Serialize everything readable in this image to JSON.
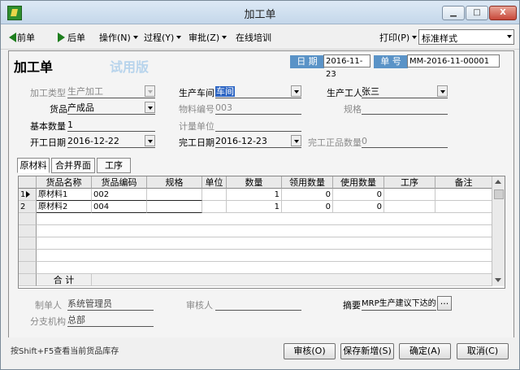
{
  "window": {
    "title": "加工单",
    "min_symbol": "▁",
    "max_symbol": "□",
    "close_symbol": "X"
  },
  "toolbar": {
    "prev": "前单",
    "next": "后单",
    "operate": "操作(N)",
    "process": "过程(Y)",
    "approve": "审批(Z)",
    "training": "在线培训",
    "print": "打印(P)",
    "style_value": "标准样式"
  },
  "form": {
    "title": "加工单",
    "trial": "试用版",
    "date_label": "日 期",
    "date_value": "2016-11-23",
    "number_label": "单 号",
    "number_value": "MM-2016-11-00001",
    "process_type_label": "加工类型",
    "process_type_value": "生产加工",
    "workshop_label": "生产车间",
    "workshop_value": "车间",
    "worker_label": "生产工人",
    "worker_value": "张三",
    "product_label": "货品",
    "product_value": "产成品",
    "material_no_label": "物料编号",
    "material_no_value": "003",
    "spec_label": "规格",
    "spec_value": "",
    "base_qty_label": "基本数量",
    "base_qty_value": "1",
    "unit_label": "计量单位",
    "unit_value": "",
    "start_date_label": "开工日期",
    "start_date_value": "2016-12-22",
    "end_date_label": "完工日期",
    "end_date_value": "2016-12-23",
    "finished_qty_label": "完工正品数量",
    "finished_qty_value": "0"
  },
  "tabs": [
    "原材料",
    "合并界面",
    "工序"
  ],
  "table": {
    "columns": [
      "货品名称",
      "货品编码",
      "规格",
      "单位",
      "数量",
      "领用数量",
      "使用数量",
      "工序",
      "备注"
    ],
    "rows": [
      {
        "rn": "1",
        "name": "原材料1",
        "code": "002",
        "spec": "",
        "unit": "",
        "qty": "1",
        "recv": "0",
        "used": "0",
        "proc": "",
        "note": ""
      },
      {
        "rn": "2",
        "name": "原材料2",
        "code": "004",
        "spec": "",
        "unit": "",
        "qty": "1",
        "recv": "0",
        "used": "0",
        "proc": "",
        "note": ""
      }
    ],
    "total_label": "合  计"
  },
  "footer": {
    "maker_label": "制单人",
    "maker_value": "系统管理员",
    "reviewer_label": "审核人",
    "reviewer_value": "",
    "summary_label": "摘要",
    "summary_value": "MRP生产建议下达的",
    "more_button": "...",
    "branch_label": "分支机构",
    "branch_value": "总部"
  },
  "status": {
    "hint": "按Shift+F5查看当前货品库存",
    "review": "审核(O)",
    "save_new": "保存新增(S)",
    "ok": "确定(A)",
    "cancel": "取消(C)"
  }
}
